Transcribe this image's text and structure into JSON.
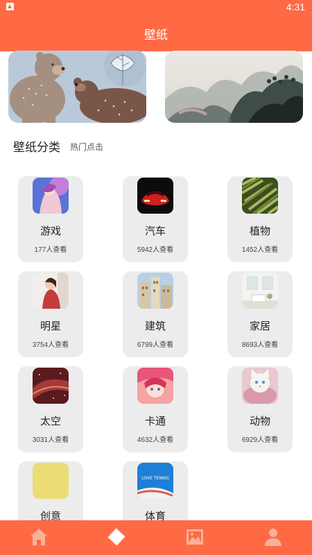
{
  "status_bar": {
    "time": "4:31"
  },
  "header": {
    "title": "壁纸"
  },
  "banners": [
    {
      "name": "bears-illustration"
    },
    {
      "name": "ink-landscape-painting"
    }
  ],
  "section": {
    "title": "壁纸分类",
    "subtitle": "热门点击"
  },
  "categories": [
    {
      "name": "游戏",
      "views": "177人查看",
      "icon": "game-art-thumbnail"
    },
    {
      "name": "汽车",
      "views": "5942人查看",
      "icon": "red-car-thumbnail"
    },
    {
      "name": "植物",
      "views": "1452人查看",
      "icon": "green-leaves-thumbnail"
    },
    {
      "name": "明星",
      "views": "3754人查看",
      "icon": "celebrity-thumbnail"
    },
    {
      "name": "建筑",
      "views": "6799人查看",
      "icon": "building-thumbnail"
    },
    {
      "name": "家居",
      "views": "8693人查看",
      "icon": "interior-thumbnail"
    },
    {
      "name": "太空",
      "views": "3031人查看",
      "icon": "space-thumbnail"
    },
    {
      "name": "卡通",
      "views": "4632人查看",
      "icon": "anime-thumbnail"
    },
    {
      "name": "动物",
      "views": "6929人查看",
      "icon": "cat-thumbnail"
    },
    {
      "name": "创意",
      "views": "",
      "icon": "yellow-square-thumbnail"
    },
    {
      "name": "体育",
      "views": "",
      "icon": "love-tennis-thumbnail",
      "thumb_text": "LOVE TENNIS"
    }
  ],
  "bottom_nav": [
    {
      "name": "home",
      "icon": "home-icon"
    },
    {
      "name": "discover",
      "icon": "pinwheel-icon"
    },
    {
      "name": "gallery",
      "icon": "image-icon"
    },
    {
      "name": "profile",
      "icon": "user-icon"
    }
  ],
  "colors": {
    "accent": "#ff6a45",
    "card": "#ececec"
  }
}
